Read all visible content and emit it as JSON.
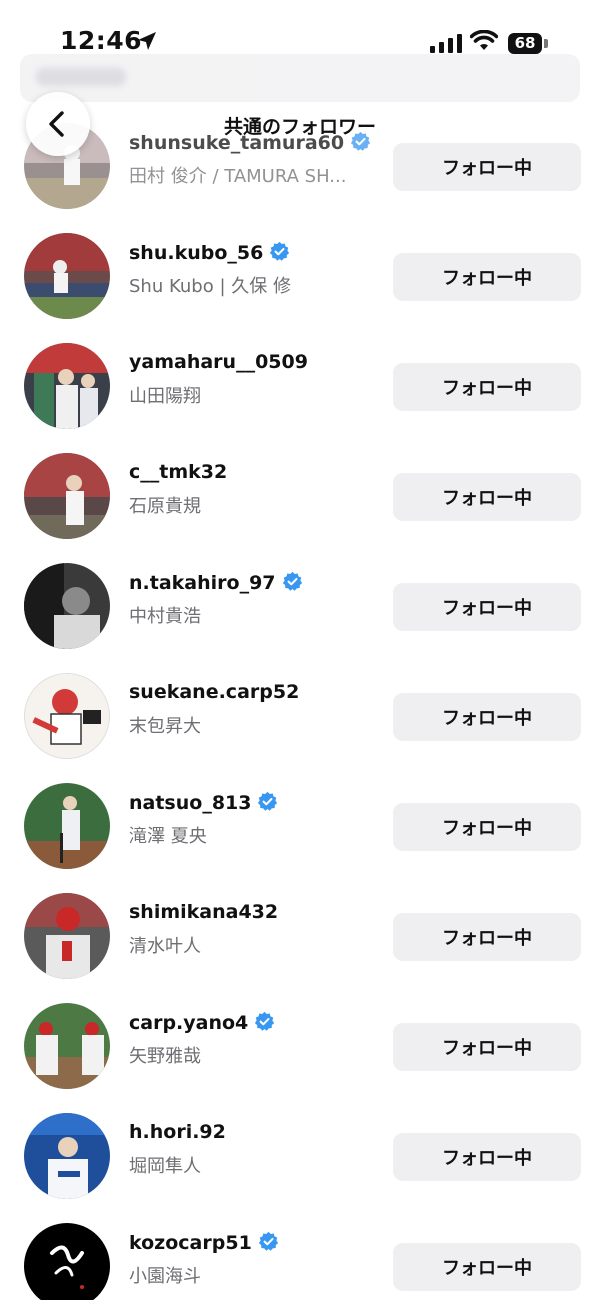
{
  "status_bar": {
    "time": "12:46",
    "battery": "68",
    "icons": [
      "location-arrow-icon",
      "cellular-signal-icon",
      "wifi-icon",
      "battery-icon"
    ]
  },
  "header": {
    "title": "共通のフォロワー",
    "back_icon": "chevron-left-icon"
  },
  "colors": {
    "verified": "#3897f0",
    "button_bg": "#efeff2",
    "secondary_text": "#6e6e73"
  },
  "users": [
    {
      "username": "shunsuke_tamura60",
      "fullname": "田村 俊介 / TAMURA SH...",
      "verified": true,
      "button": "フォロー中"
    },
    {
      "username": "shu.kubo_56",
      "fullname": "Shu Kubo | 久保 修",
      "verified": true,
      "button": "フォロー中"
    },
    {
      "username": "yamaharu__0509",
      "fullname": "山田陽翔",
      "verified": false,
      "button": "フォロー中"
    },
    {
      "username": "c__tmk32",
      "fullname": "石原貴規",
      "verified": false,
      "button": "フォロー中"
    },
    {
      "username": "n.takahiro_97",
      "fullname": "中村貴浩",
      "verified": true,
      "button": "フォロー中"
    },
    {
      "username": "suekane.carp52",
      "fullname": "末包昇大",
      "verified": false,
      "button": "フォロー中"
    },
    {
      "username": "natsuo_813",
      "fullname": "滝澤 夏央",
      "verified": true,
      "button": "フォロー中"
    },
    {
      "username": "shimikana432",
      "fullname": "清水叶人",
      "verified": false,
      "button": "フォロー中"
    },
    {
      "username": "carp.yano4",
      "fullname": "矢野雅哉",
      "verified": true,
      "button": "フォロー中"
    },
    {
      "username": "h.hori.92",
      "fullname": "堀岡隼人",
      "verified": false,
      "button": "フォロー中"
    },
    {
      "username": "kozocarp51",
      "fullname": "小園海斗",
      "verified": true,
      "button": "フォロー中"
    }
  ]
}
